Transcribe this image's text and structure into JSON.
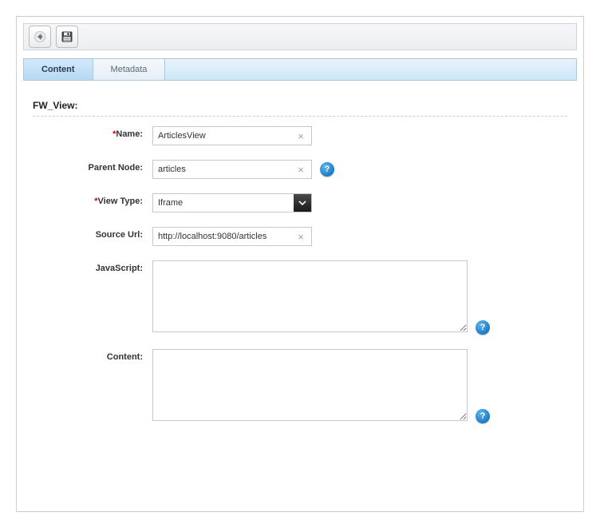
{
  "toolbar": {
    "back_icon": "arrow-left",
    "save_icon": "floppy-disk"
  },
  "tabs": {
    "content": "Content",
    "metadata": "Metadata"
  },
  "section": {
    "title": "FW_View:"
  },
  "form": {
    "name_label": "Name:",
    "name_value": "ArticlesView",
    "parent_label": "Parent Node:",
    "parent_value": "articles",
    "viewtype_label": "View Type:",
    "viewtype_value": "Iframe",
    "sourceurl_label": "Source Url:",
    "sourceurl_value": "http://localhost:9080/articles",
    "javascript_label": "JavaScript:",
    "javascript_value": "",
    "content_label": "Content:",
    "content_value": "",
    "required_marker": "*",
    "help_glyph": "?",
    "clear_glyph": "×"
  }
}
